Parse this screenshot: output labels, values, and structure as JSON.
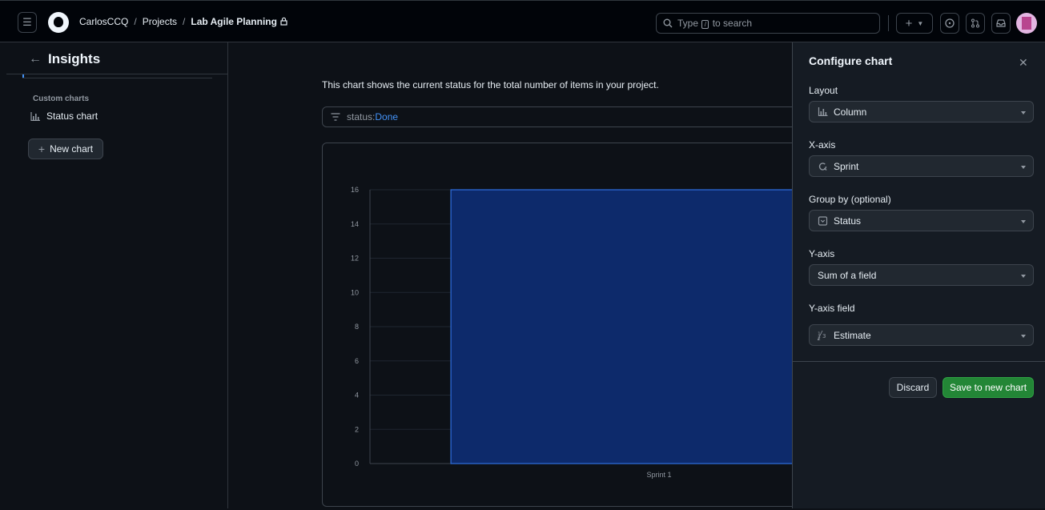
{
  "breadcrumb": {
    "owner": "CarlosCCQ",
    "projects": "Projects",
    "project": "Lab Agile Planning"
  },
  "search": {
    "prefix": "Type",
    "key": "/",
    "suffix": "to search"
  },
  "sidebar": {
    "title": "Insights",
    "section_label": "Custom charts",
    "items": [
      {
        "label": "Status chart",
        "icon": "bar-chart-icon"
      }
    ],
    "new_chart_label": "New chart"
  },
  "main": {
    "description": "This chart shows the current status for the total number of items in your project.",
    "filter": {
      "key": "status:",
      "value": "Done"
    }
  },
  "chart_data": {
    "type": "bar",
    "categories": [
      "Sprint 1"
    ],
    "values": [
      16
    ],
    "ylim": [
      0,
      16
    ],
    "yticks": [
      0,
      2,
      4,
      6,
      8,
      10,
      12,
      14,
      16
    ],
    "grid": true,
    "bar_color": "#0d2a6b"
  },
  "panel": {
    "title": "Configure chart",
    "fields": [
      {
        "label": "Layout",
        "value": "Column",
        "icon": "bar-chart-icon"
      },
      {
        "label": "X-axis",
        "value": "Sprint",
        "icon": "iteration-icon"
      },
      {
        "label": "Group by (optional)",
        "value": "Status",
        "icon": "single-select-icon"
      },
      {
        "label": "Y-axis",
        "value": "Sum of a field",
        "icon": ""
      },
      {
        "label": "Y-axis field",
        "value": "Estimate",
        "icon": "number-icon"
      }
    ],
    "discard_label": "Discard",
    "save_label": "Save to new chart"
  },
  "colors": {
    "accent": "#4493f8",
    "save_button": "#238636",
    "background": "#0d1117"
  }
}
